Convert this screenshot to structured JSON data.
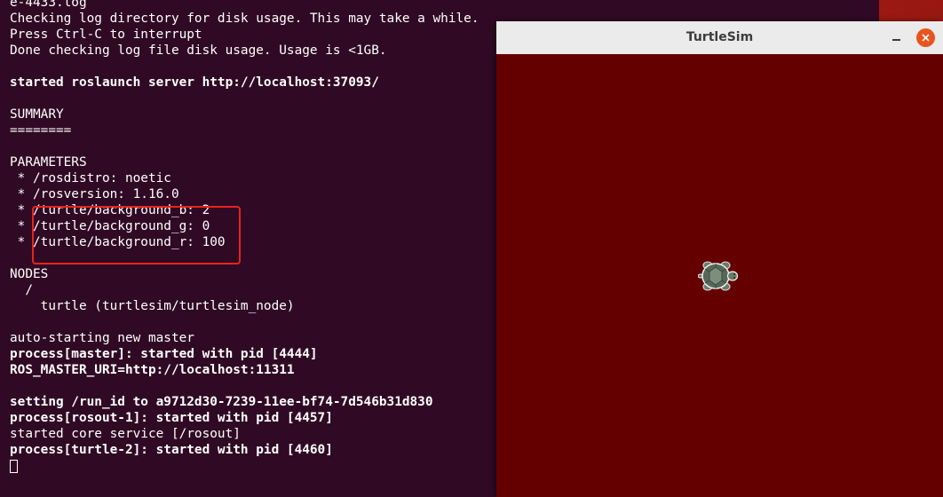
{
  "terminal": {
    "lines": [
      {
        "text": "e-4433.log",
        "bold": false
      },
      {
        "text": "Checking log directory for disk usage. This may take a while.",
        "bold": false
      },
      {
        "text": "Press Ctrl-C to interrupt",
        "bold": false
      },
      {
        "text": "Done checking log file disk usage. Usage is <1GB.",
        "bold": false
      },
      {
        "text": "",
        "bold": false
      },
      {
        "text": "started roslaunch server http://localhost:37093/",
        "bold": true
      },
      {
        "text": "",
        "bold": false
      },
      {
        "text": "SUMMARY",
        "bold": false
      },
      {
        "text": "========",
        "bold": false
      },
      {
        "text": "",
        "bold": false
      },
      {
        "text": "PARAMETERS",
        "bold": false
      },
      {
        "text": " * /rosdistro: noetic",
        "bold": false
      },
      {
        "text": " * /rosversion: 1.16.0",
        "bold": false
      },
      {
        "text": " * /turtle/background_b: 2",
        "bold": false
      },
      {
        "text": " * /turtle/background_g: 0",
        "bold": false
      },
      {
        "text": " * /turtle/background_r: 100",
        "bold": false
      },
      {
        "text": "",
        "bold": false
      },
      {
        "text": "NODES",
        "bold": false
      },
      {
        "text": "  /",
        "bold": false
      },
      {
        "text": "    turtle (turtlesim/turtlesim_node)",
        "bold": false
      },
      {
        "text": "",
        "bold": false
      },
      {
        "text": "auto-starting new master",
        "bold": false
      },
      {
        "text": "process[master]: started with pid [4444]",
        "bold": true
      },
      {
        "text": "ROS_MASTER_URI=http://localhost:11311",
        "bold": true
      },
      {
        "text": "",
        "bold": false
      },
      {
        "text": "setting /run_id to a9712d30-7239-11ee-bf74-7d546b31d830",
        "bold": true
      },
      {
        "text": "process[rosout-1]: started with pid [4457]",
        "bold": true
      },
      {
        "text": "started core service [/rosout]",
        "bold": false
      },
      {
        "text": "process[turtle-2]: started with pid [4460]",
        "bold": true
      }
    ],
    "background": "#300a24",
    "highlight_color": "#e8231c"
  },
  "turtlesim": {
    "title": "TurtleSim",
    "canvas_color": "#640000",
    "close_color": "#e9541e",
    "icons": {
      "minimize": "minimize-icon",
      "close": "close-icon",
      "turtle": "turtle-icon"
    }
  }
}
